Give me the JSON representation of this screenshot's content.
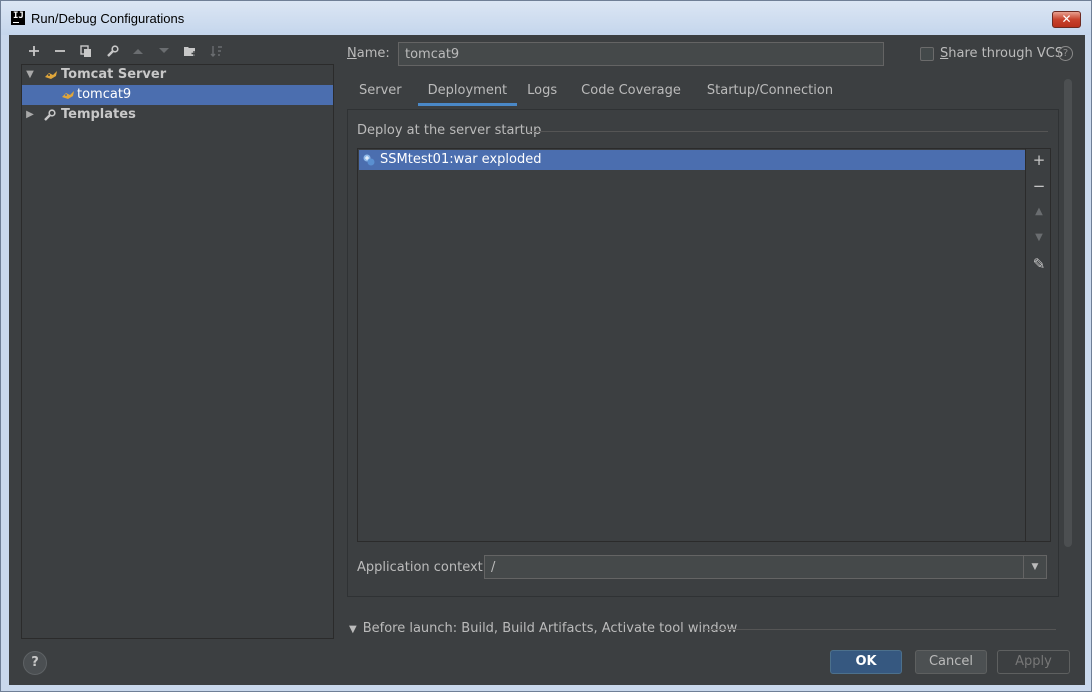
{
  "window": {
    "title": "Run/Debug Configurations",
    "app_icon_text": "IJ",
    "close_label": "✕"
  },
  "left_toolbar": [
    {
      "name": "add-config",
      "icon": "plus-icon",
      "enabled": true
    },
    {
      "name": "remove-config",
      "icon": "minus-icon",
      "enabled": true
    },
    {
      "name": "copy-config",
      "icon": "copy-icon",
      "enabled": true
    },
    {
      "name": "edit-defaults",
      "icon": "wrench-icon",
      "enabled": true
    },
    {
      "name": "move-up",
      "icon": "arrow-up-icon",
      "enabled": false
    },
    {
      "name": "move-down",
      "icon": "arrow-down-icon",
      "enabled": false
    },
    {
      "name": "new-folder",
      "icon": "folder-add-icon",
      "enabled": true
    },
    {
      "name": "sort",
      "icon": "sort-icon",
      "enabled": false
    }
  ],
  "tree": {
    "tomcat_server": {
      "label": "Tomcat Server",
      "expanded": true
    },
    "tomcat9": {
      "label": "tomcat9",
      "selected": true
    },
    "templates": {
      "label": "Templates",
      "expanded": false
    }
  },
  "name_field": {
    "label_prefix": "",
    "label_mnemonic": "N",
    "label_rest": "ame:",
    "value": "tomcat9"
  },
  "share": {
    "mnemonic": "S",
    "label_rest": "hare through VCS",
    "checked": false,
    "help": "?"
  },
  "tabs": [
    {
      "label": "Server",
      "active": false
    },
    {
      "label": "Deployment",
      "active": true
    },
    {
      "label": "Logs",
      "active": false
    },
    {
      "label": "Code Coverage",
      "active": false
    },
    {
      "label": "Startup/Connection",
      "active": false
    }
  ],
  "deploy": {
    "title": "Deploy at the server startup",
    "items": [
      {
        "label": "SSMtest01:war exploded",
        "icon": "artifact-icon",
        "selected": true
      }
    ],
    "side_buttons": [
      {
        "icon": "plus-icon",
        "glyph": "+",
        "enabled": true
      },
      {
        "icon": "minus-icon",
        "glyph": "−",
        "enabled": true
      },
      {
        "icon": "arrow-up-icon",
        "glyph": "▲",
        "enabled": false
      },
      {
        "icon": "arrow-down-icon",
        "glyph": "▼",
        "enabled": false
      },
      {
        "icon": "pencil-icon",
        "glyph": "✎",
        "enabled": true
      }
    ]
  },
  "app_context": {
    "label": "Application context:",
    "value": "/"
  },
  "before_launch": {
    "label": "Before launch: Build, Build Artifacts, Activate tool window"
  },
  "buttons": {
    "help": "?",
    "ok": "OK",
    "cancel": "Cancel",
    "apply": "Apply"
  },
  "colors": {
    "background": "#3c3f41",
    "selection": "#4b6eaf",
    "accent_tab": "#4a88c7",
    "ok_button": "#365880"
  }
}
